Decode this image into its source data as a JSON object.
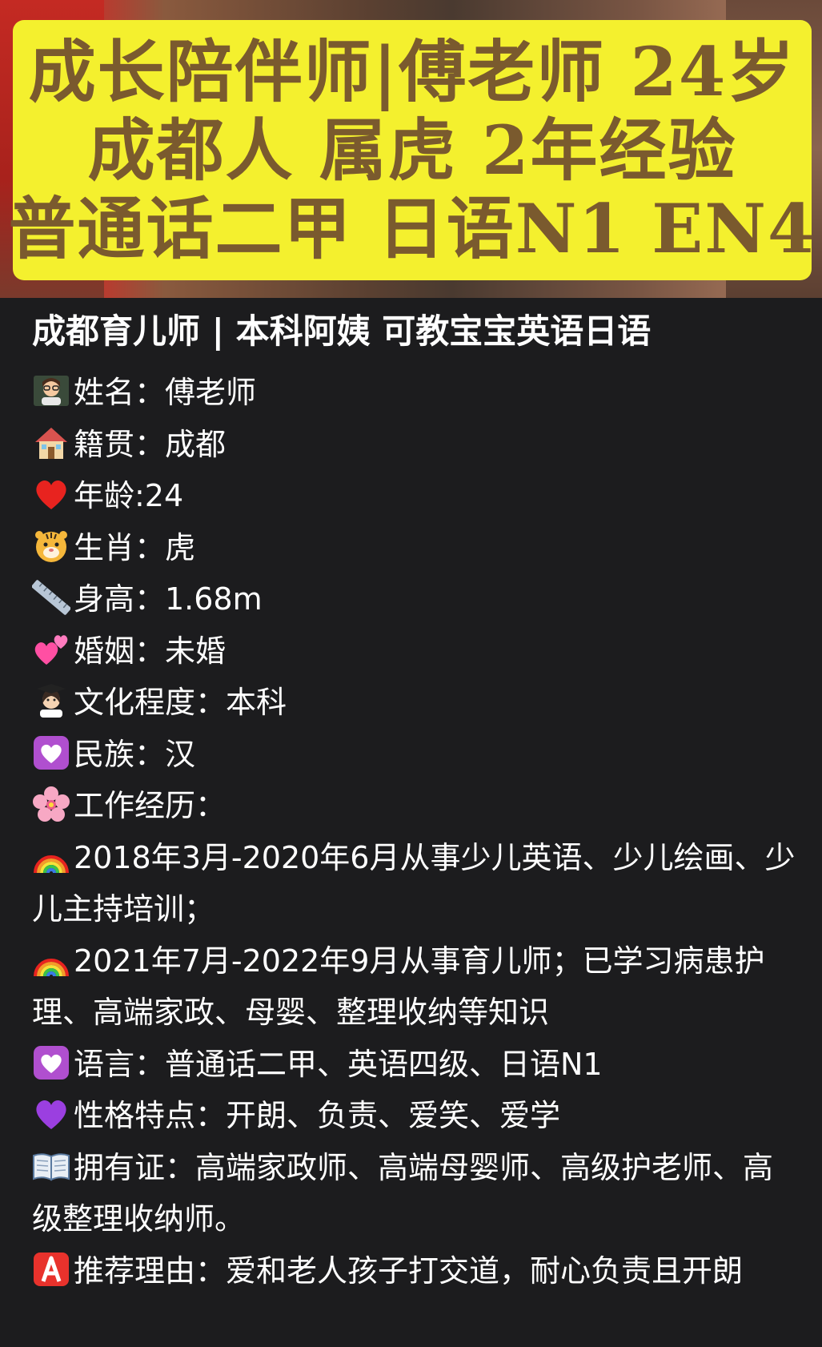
{
  "cover": {
    "lines": [
      "成长陪伴师|傅老师 24岁",
      "成都人 属虎 2年经验",
      "普通话二甲 日语N1 EN4"
    ]
  },
  "post": {
    "title": "成都育儿师 | 本科阿姨 可教宝宝英语日语",
    "rows": [
      {
        "icon": "teacher-emoji-icon",
        "text": "姓名：傅老师"
      },
      {
        "icon": "house-emoji-icon",
        "text": "籍贯：成都"
      },
      {
        "icon": "red-heart-emoji-icon",
        "text": "年龄:24"
      },
      {
        "icon": "tiger-face-emoji-icon",
        "text": "生肖：虎"
      },
      {
        "icon": "ruler-emoji-icon",
        "text": "身高：1.68m"
      },
      {
        "icon": "two-hearts-emoji-icon",
        "text": "婚姻：未婚"
      },
      {
        "icon": "student-emoji-icon",
        "text": "文化程度：本科"
      },
      {
        "icon": "heart-decoration-emoji-icon",
        "text": "民族：汉"
      },
      {
        "icon": "cherry-blossom-emoji-icon",
        "text": "工作经历："
      },
      {
        "icon": "rainbow-emoji-icon",
        "text": "2018年3月-2020年6月从事少儿英语、少儿绘画、少儿主持培训；"
      },
      {
        "icon": "rainbow-emoji-icon",
        "text": "2021年7月-2022年9月从事育儿师；已学习病患护理、高端家政、母婴、整理收纳等知识"
      },
      {
        "icon": "heart-decoration-emoji-icon",
        "text": "语言：普通话二甲、英语四级、日语N1"
      },
      {
        "icon": "purple-heart-emoji-icon",
        "text": "性格特点：开朗、负责、爱笑、爱学"
      },
      {
        "icon": "open-book-emoji-icon",
        "text": "拥有证：高端家政师、高端母婴师、高级护老师、高级整理收纳师。"
      },
      {
        "icon": "a-button-emoji-icon",
        "text": "推荐理由：爱和老人孩子打交道，耐心负责且开朗"
      }
    ]
  }
}
